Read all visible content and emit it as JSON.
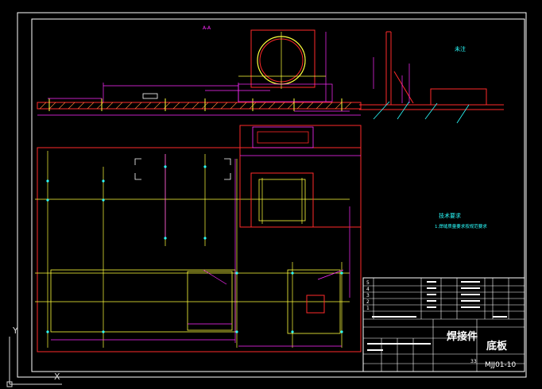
{
  "app": {
    "background_color": "#000000"
  },
  "drawing": {
    "section_label": "A-A",
    "weld_symbol_text": "未注",
    "tech_requirements": {
      "title": "技术要求",
      "item_1": "1.焊缝质量要求按规范要求"
    },
    "title_block": {
      "category": "焊接件",
      "part_name": "底板",
      "drawing_number": "MJJ01-10",
      "sheet_count": "33",
      "row_numbers": [
        "5",
        "4",
        "3",
        "2",
        "1"
      ]
    },
    "colors": {
      "frame": "#ffffff",
      "outline": "#ff2a2a",
      "dimension": "#ff2bff",
      "centerline": "#ffff3c",
      "accent": "#2bffff",
      "hatch": "#ff8c3c"
    }
  },
  "ucs": {
    "y_label": "Y",
    "x_label": "X"
  }
}
